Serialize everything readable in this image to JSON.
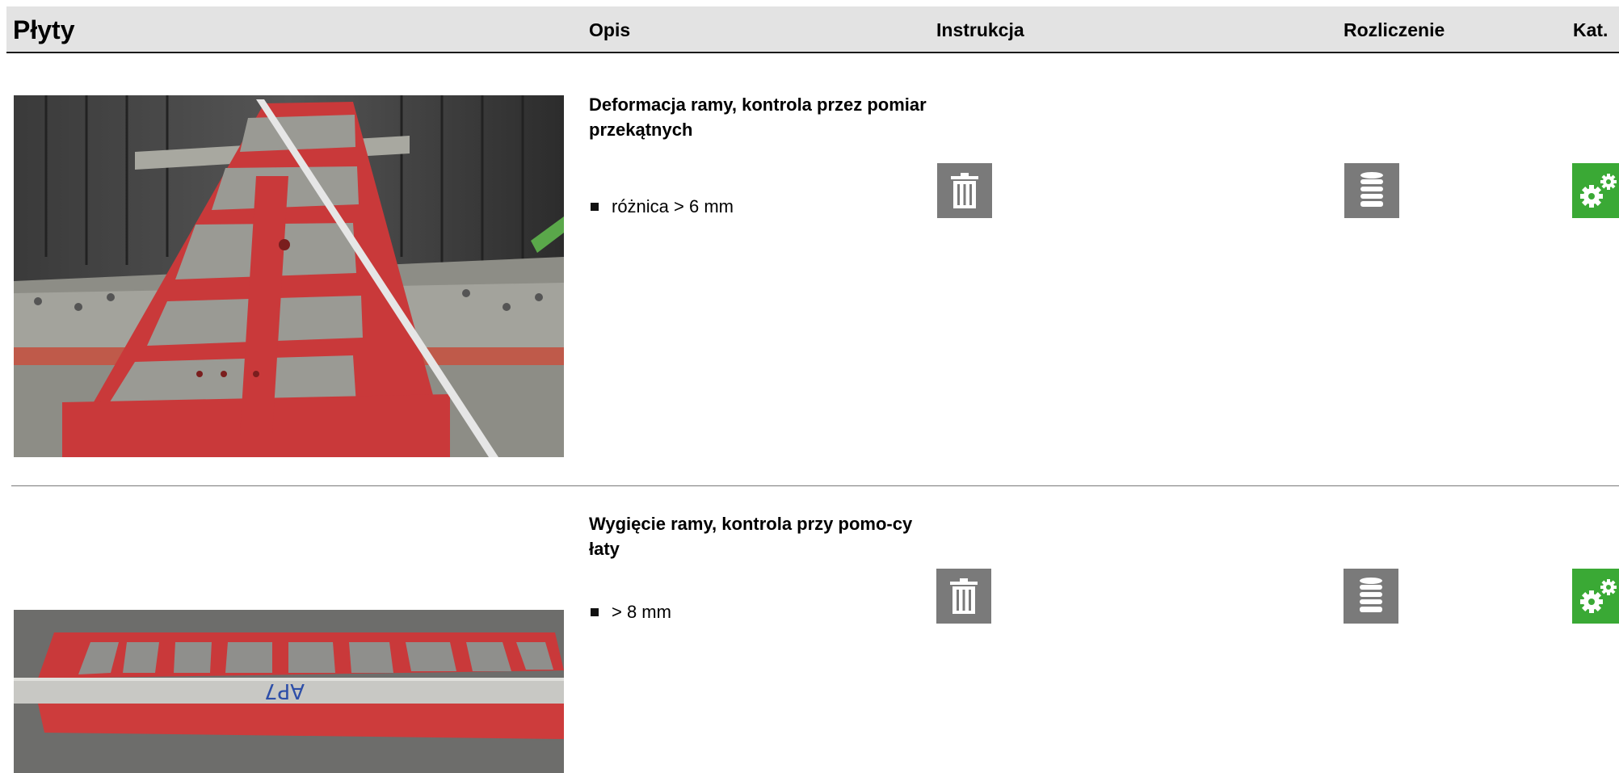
{
  "header": {
    "title": "Płyty",
    "opis": "Opis",
    "instrukcja": "Instrukcja",
    "rozliczenie": "Rozliczenie",
    "kat": "Kat."
  },
  "rows": [
    {
      "title": "Deformacja ramy, kontrola przez pomiar przekątnych",
      "bullet": "różnica > 6 mm"
    },
    {
      "title": "Wygięcie ramy, kontrola przy pomo-cy łaty",
      "bullet": "> 8 mm"
    }
  ],
  "icons": {
    "instruction": "trash-icon",
    "billing": "stack-icon",
    "category": "gears-icon"
  },
  "colors": {
    "header_bg": "#e3e3e3",
    "icon_gray": "#7a7a7a",
    "icon_green": "#3aa935",
    "frame_red": "#cc3a3a"
  }
}
